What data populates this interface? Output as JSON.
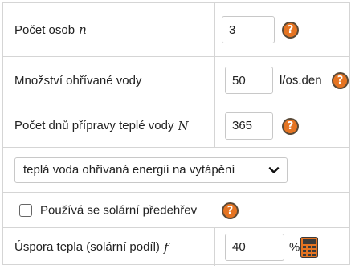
{
  "rows": {
    "persons": {
      "label": "Počet osob",
      "var": "n",
      "value": "3"
    },
    "water": {
      "label": "Množství ohřívané vody",
      "value": "50",
      "unit": "l/os.den"
    },
    "days": {
      "label": "Počet dnů přípravy teplé vody",
      "var": "N",
      "value": "365"
    },
    "heating": {
      "selected": "teplá voda ohřívaná energií na vytápění"
    },
    "solar": {
      "label": "Používá se solární předehřev",
      "checked": false
    },
    "saving": {
      "label": "Úspora tepla (solární podíl)",
      "var": "f",
      "value": "40",
      "unit": "%"
    }
  },
  "icons": {
    "help": "help-question-icon",
    "calculator": "calculator-icon",
    "chevron": "chevron-down-icon"
  },
  "colors": {
    "help_fill": "#e57422",
    "help_border": "#5a4a38",
    "calculator": "#e57422",
    "border": "#d5d5d5"
  }
}
